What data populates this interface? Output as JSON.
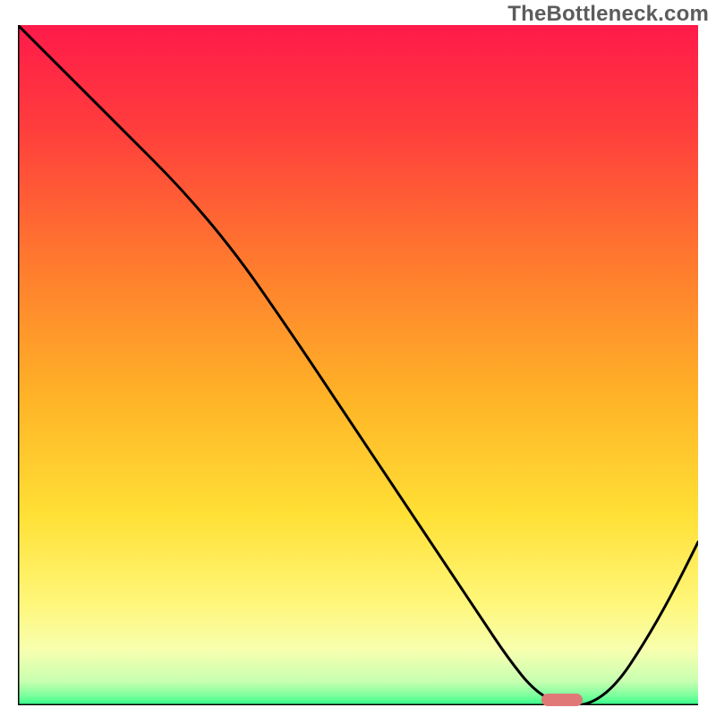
{
  "watermark": "TheBottleneck.com",
  "chart_data": {
    "type": "line",
    "title": "",
    "xlabel": "",
    "ylabel": "",
    "xlim": [
      0,
      100
    ],
    "ylim": [
      0,
      100
    ],
    "grid": false,
    "legend": false,
    "series": [
      {
        "name": "curve",
        "color": "#000000",
        "x": [
          0,
          8,
          16,
          24,
          32,
          40,
          48,
          56,
          64,
          68,
          72,
          76,
          80,
          84,
          88,
          92,
          96,
          100
        ],
        "values": [
          100,
          92,
          84,
          76,
          66.5,
          55,
          43,
          31,
          19,
          13,
          7,
          2,
          0,
          0,
          3,
          9,
          16,
          24
        ]
      }
    ],
    "background_gradient": {
      "direction": "top-to-bottom",
      "stops": [
        {
          "offset": 0,
          "color": "#ff1a4a"
        },
        {
          "offset": 0.15,
          "color": "#ff3d3d"
        },
        {
          "offset": 0.35,
          "color": "#ff7a2e"
        },
        {
          "offset": 0.55,
          "color": "#ffb427"
        },
        {
          "offset": 0.72,
          "color": "#ffe035"
        },
        {
          "offset": 0.85,
          "color": "#fff77a"
        },
        {
          "offset": 0.92,
          "color": "#f7ffb0"
        },
        {
          "offset": 0.965,
          "color": "#c8ffb0"
        },
        {
          "offset": 0.985,
          "color": "#7fff9e"
        },
        {
          "offset": 1.0,
          "color": "#2fff8a"
        }
      ]
    },
    "marker": {
      "x_range": [
        77,
        83
      ],
      "y": 0.8,
      "color": "#e07878",
      "height": 1.8
    },
    "axis_color": "#000000",
    "axis_width": 3
  }
}
